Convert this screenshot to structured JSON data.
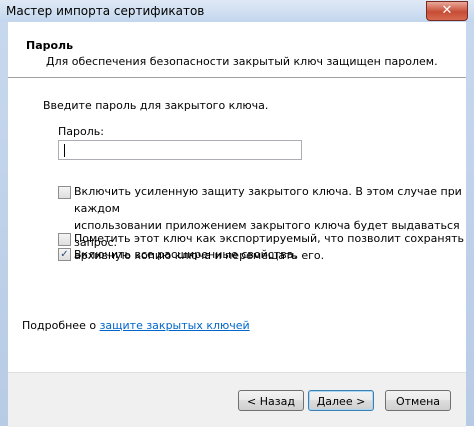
{
  "window": {
    "title": "Мастер импорта сертификатов",
    "close_glyph": "✕"
  },
  "header": {
    "title": "Пароль",
    "subtitle": "Для обеспечения безопасности закрытый ключ защищен паролем."
  },
  "main": {
    "prompt": "Введите пароль для закрытого ключа.",
    "password_label": "Пароль:",
    "password_value": "",
    "options": [
      {
        "line1": "Включить усиленную защиту закрытого ключа. В этом случае при каждом",
        "line2": "использовании приложением закрытого ключа будет выдаваться запрос.",
        "checked": false
      },
      {
        "line1": "Пометить этот ключ как экспортируемый, что позволит сохранять",
        "line2": "архивную копию ключа и перемещать его.",
        "checked": false
      },
      {
        "line1": "Включить все расширенные свойства.",
        "line2": "",
        "checked": true
      }
    ],
    "more_info_prefix": "Подробнее о ",
    "more_info_link": "защите закрытых ключей"
  },
  "footer": {
    "back_label": "< Назад",
    "next_label": "Далее >",
    "cancel_label": "Отмена"
  }
}
